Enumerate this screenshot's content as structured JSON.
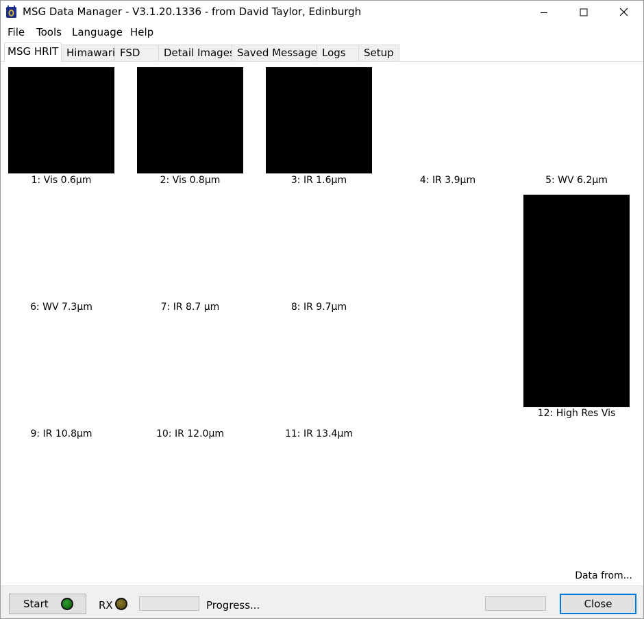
{
  "window": {
    "title": "MSG Data Manager - V3.1.20.1336 - from David Taylor, Edinburgh",
    "icons": {
      "app": "msg-satellite-app-icon",
      "minimize": "minimize-icon",
      "maximize": "maximize-icon",
      "close": "close-icon"
    }
  },
  "menu": [
    "File",
    "Tools",
    "Language",
    "Help"
  ],
  "tabs": [
    "MSG HRIT",
    "Himawari",
    "FSD",
    "Detail Images",
    "Saved Messages",
    "Logs",
    "Setup"
  ],
  "active_tab": "MSG HRIT",
  "channels": [
    {
      "label": "1:  Vis 0.6µm",
      "has_image": true
    },
    {
      "label": "2:  Vis 0.8µm",
      "has_image": true
    },
    {
      "label": "3:  IR 1.6µm",
      "has_image": true
    },
    {
      "label": "4:  IR 3.9µm",
      "has_image": false
    },
    {
      "label": "5:  WV 6.2µm",
      "has_image": false
    },
    {
      "label": "6:  WV 7.3µm",
      "has_image": false
    },
    {
      "label": "7:  IR 8.7 µm",
      "has_image": false
    },
    {
      "label": "8:  IR 9.7µm",
      "has_image": false
    },
    {
      "label": "9:  IR 10.8µm",
      "has_image": false
    },
    {
      "label": "10:  IR 12.0µm",
      "has_image": false
    },
    {
      "label": "11:  IR 13.4µm",
      "has_image": false
    },
    {
      "label": "12:  High Res Vis",
      "has_image": true
    }
  ],
  "data_from": "Data from...",
  "status": {
    "start_label": "Start",
    "start_led_color": "#1f7a1f",
    "rx_label": "RX",
    "rx_led_color": "#6b5f1e",
    "progress_text": "Progress...",
    "close_label": "Close"
  }
}
